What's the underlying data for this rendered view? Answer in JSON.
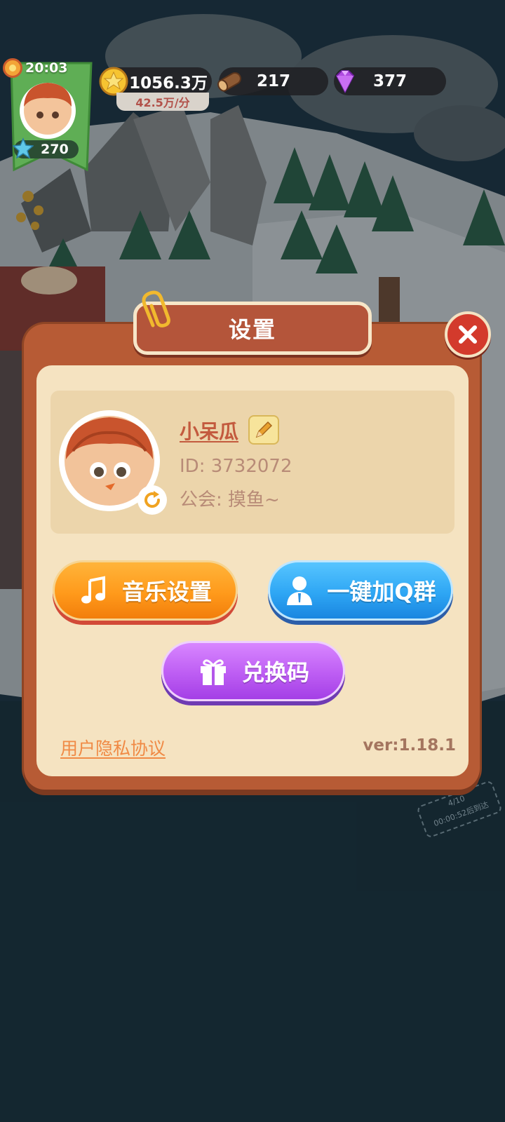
{
  "hud": {
    "time": "20:03",
    "level": "270",
    "coins": "1056.3万",
    "coin_rate": "42.5万/分",
    "wood": "217",
    "gems": "377"
  },
  "dialog": {
    "title": "设置",
    "profile": {
      "nickname": "小呆瓜",
      "id_text": "ID: 3732072",
      "guild_text": "公会: 摸鱼~"
    },
    "buttons": {
      "music": "音乐设置",
      "qq_group": "一键加Q群",
      "redeem": "兑换码"
    },
    "privacy_link": "用户隐私协议",
    "version": "ver:1.18.1"
  },
  "background": {
    "ship_progress": "4/10",
    "ship_eta": "00:00:52后到达"
  },
  "colors": {
    "dialog_frame": "#b75b35",
    "dialog_inner": "#f5e3c1",
    "music_button": "#ff9a1b",
    "qq_button": "#2ea6f4",
    "redeem_button": "#bd5df3",
    "close_button": "#d33a2c"
  }
}
